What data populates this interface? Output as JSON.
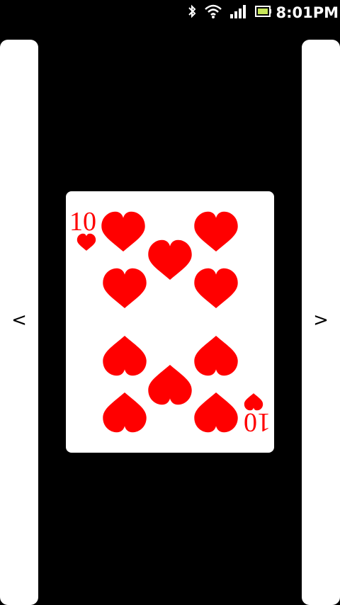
{
  "status_bar": {
    "time": "8:01PM",
    "icons": [
      "bluetooth-icon",
      "wifi-icon",
      "signal-icon",
      "battery-icon"
    ]
  },
  "navigation": {
    "prev_label": "<",
    "next_label": ">"
  },
  "card": {
    "rank": "10",
    "suit": "hearts",
    "suit_color": "#ff0000",
    "corner_top_rank": "10",
    "corner_bottom_rank": "10"
  }
}
